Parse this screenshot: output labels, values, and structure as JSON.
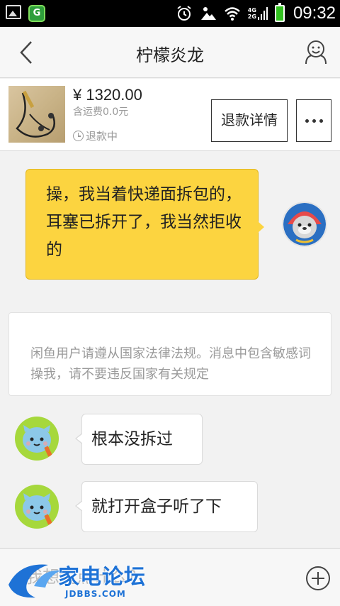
{
  "status_bar": {
    "network_top": "4G",
    "network_bottom": "2G",
    "time": "09:32",
    "icons": [
      "image-icon",
      "app-icon",
      "alarm-icon",
      "weather-icon",
      "wifi-icon",
      "signal-icon",
      "battery-icon"
    ]
  },
  "header": {
    "title": "柠檬炎龙",
    "back_icon": "chevron-left-icon",
    "profile_icon": "smiley-icon"
  },
  "product": {
    "price": "¥ 1320.00",
    "shipping": "含运费0.0元",
    "status": "退款中",
    "refund_button": "退款详情",
    "more_icon": "more-dots-icon"
  },
  "messages": [
    {
      "from": "me",
      "text": "操，我当着快递面拆包的，耳塞已拆开了，我当然拒收的"
    },
    {
      "from": "system",
      "text": "闲鱼用户请遵从国家法律法规。消息中包含敏感词 操我，请不要违反国家有关规定"
    },
    {
      "from": "other",
      "text": "根本没拆过"
    },
    {
      "from": "other",
      "text": "就打开盒子听了下"
    }
  ],
  "input": {
    "placeholder": "我想说点什么？",
    "add_icon": "plus-circle-icon"
  },
  "watermark": {
    "name": "家电论坛",
    "domain": "JDBBS.COM"
  },
  "colors": {
    "bubble_outgoing": "#fcd440",
    "avatar_other_bg": "#a6d83c",
    "watermark": "#1e72d6"
  }
}
